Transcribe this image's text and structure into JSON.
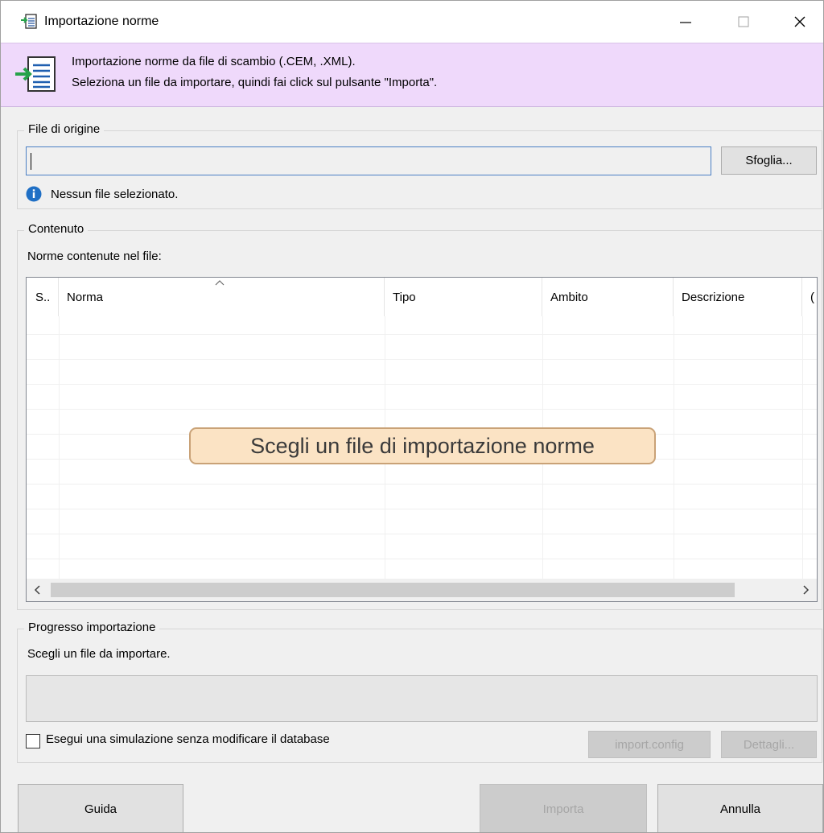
{
  "window": {
    "title": "Importazione norme",
    "controls": {
      "minimize": "minimize-icon",
      "maximize": "maximize-icon",
      "close": "close-icon"
    }
  },
  "header": {
    "line1": "Importazione norme da file di scambio (.CEM, .XML).",
    "line2": "Seleziona un file da importare, quindi fai click sul pulsante \"Importa\"."
  },
  "source": {
    "group_title": "File di origine",
    "file_value": "",
    "browse_label": "Sfoglia...",
    "info_text": "Nessun file selezionato."
  },
  "content": {
    "group_title": "Contenuto",
    "caption": "Norme contenute nel file:",
    "columns": [
      "S..",
      "Norma",
      "Tipo",
      "Ambito",
      "Descrizione",
      "("
    ],
    "sort_column": "Norma",
    "empty_overlay": "Scegli un file di importazione norme"
  },
  "progress": {
    "group_title": "Progresso importazione",
    "status_text": "Scegli un file da importare.",
    "value": 0,
    "simulate_label": "Esegui una simulazione senza modificare il database",
    "simulate_checked": false,
    "config_label": "import.config",
    "details_label": "Dettagli..."
  },
  "footer": {
    "help_label": "Guida",
    "import_label": "Importa",
    "cancel_label": "Annulla"
  },
  "colors": {
    "header_bg": "#efd9fb",
    "info_icon": "#1f6fc5",
    "overlay_bg": "#fbe3c4",
    "input_border": "#4a7fc4"
  }
}
